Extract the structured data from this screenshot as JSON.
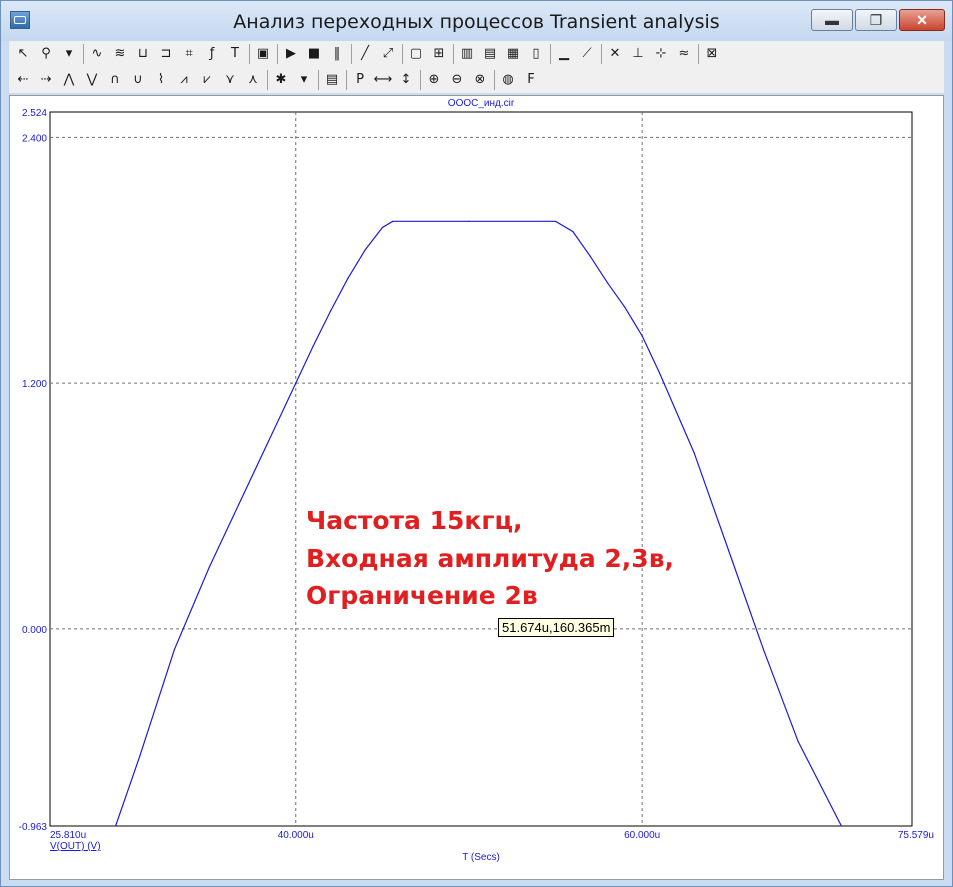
{
  "window": {
    "title": "Анализ переходных процессов Transient analysis"
  },
  "titlebar_buttons": {
    "min": "▬",
    "max": "❐",
    "close": "✕"
  },
  "toolbar1": [
    {
      "name": "select-arrow-icon",
      "glyph": "↖"
    },
    {
      "name": "scale-icon",
      "glyph": "⚲"
    },
    {
      "name": "dropdown-arrow-icon",
      "glyph": "▾"
    },
    {
      "name": "waveform-icon",
      "glyph": "∿"
    },
    {
      "name": "waveform-2-icon",
      "glyph": "≋"
    },
    {
      "name": "waveform-3-icon",
      "glyph": "⊔"
    },
    {
      "name": "waveform-4-icon",
      "glyph": "⊐"
    },
    {
      "name": "data-points-icon",
      "glyph": "⌗"
    },
    {
      "name": "formula-icon",
      "glyph": "ƒ"
    },
    {
      "name": "text-icon",
      "glyph": "T"
    },
    {
      "name": "properties-icon",
      "glyph": "▣"
    },
    {
      "name": "run-icon",
      "glyph": "▶"
    },
    {
      "name": "stop-icon",
      "glyph": "■"
    },
    {
      "name": "pause-icon",
      "glyph": "‖"
    },
    {
      "name": "line-icon",
      "glyph": "╱"
    },
    {
      "name": "line-2-icon",
      "glyph": "⤢"
    },
    {
      "name": "frame-icon",
      "glyph": "▢"
    },
    {
      "name": "grid-icon",
      "glyph": "⊞"
    },
    {
      "name": "grid-v-icon",
      "glyph": "▥"
    },
    {
      "name": "grid-h-icon",
      "glyph": "▤"
    },
    {
      "name": "grid-2-icon",
      "glyph": "▦"
    },
    {
      "name": "grid-3-icon",
      "glyph": "▯"
    },
    {
      "name": "baseline-icon",
      "glyph": "▁"
    },
    {
      "name": "trace-icon",
      "glyph": "⟋"
    },
    {
      "name": "marker-icon",
      "glyph": "✕"
    },
    {
      "name": "marker-2-icon",
      "glyph": "⊥"
    },
    {
      "name": "marker-3-icon",
      "glyph": "⊹"
    },
    {
      "name": "marker-4-icon",
      "glyph": "≈"
    },
    {
      "name": "clear-icon",
      "glyph": "⊠"
    }
  ],
  "toolbar2": [
    {
      "name": "cursor-left-icon",
      "glyph": "⇠"
    },
    {
      "name": "cursor-right-icon",
      "glyph": "⇢"
    },
    {
      "name": "peak-icon",
      "glyph": "⋀"
    },
    {
      "name": "valley-icon",
      "glyph": "⋁"
    },
    {
      "name": "high-icon",
      "glyph": "∩"
    },
    {
      "name": "low-icon",
      "glyph": "∪"
    },
    {
      "name": "inflection-icon",
      "glyph": "⌇"
    },
    {
      "name": "global-high-icon",
      "glyph": "⩘"
    },
    {
      "name": "global-low-icon",
      "glyph": "⩗"
    },
    {
      "name": "top-icon",
      "glyph": "⋎"
    },
    {
      "name": "bottom-icon",
      "glyph": "⋏"
    },
    {
      "name": "tokens-icon",
      "glyph": "✱"
    },
    {
      "name": "dropdown-2-icon",
      "glyph": "▾"
    },
    {
      "name": "table-icon",
      "glyph": "▤"
    },
    {
      "name": "point-tag-icon",
      "glyph": "P"
    },
    {
      "name": "horizontal-tag-icon",
      "glyph": "⟷"
    },
    {
      "name": "vertical-tag-icon",
      "glyph": "↕"
    },
    {
      "name": "zoom-in-icon",
      "glyph": "⊕"
    },
    {
      "name": "zoom-out-icon",
      "glyph": "⊖"
    },
    {
      "name": "zoom-fit-icon",
      "glyph": "⊗"
    },
    {
      "name": "color-icon",
      "glyph": "◍"
    },
    {
      "name": "font-icon",
      "glyph": "F"
    }
  ],
  "colors": {
    "trace": "#1a1adc",
    "axis_text": "#1a1adc",
    "grid": "#707070",
    "annotation": "#e02020"
  },
  "chart_data": {
    "type": "line",
    "title": "OOOC_инд.cir",
    "xlabel": "T (Secs)",
    "ylabel": "",
    "series_label": "V(OUT) (V)",
    "xlim": [
      25.81,
      75.579
    ],
    "ylim": [
      -0.963,
      2.524
    ],
    "x_unit": "u",
    "x_ticks": [
      {
        "v": 25.81,
        "label": "25.810u"
      },
      {
        "v": 40,
        "label": "40.000u"
      },
      {
        "v": 60,
        "label": "60.000u"
      },
      {
        "v": 75.579,
        "label": "75.579u"
      }
    ],
    "y_ticks": [
      {
        "v": 2.524,
        "label": "2.524"
      },
      {
        "v": 2.4,
        "label": "2.400"
      },
      {
        "v": 1.2,
        "label": "1.200"
      },
      {
        "v": 0,
        "label": "0.000"
      },
      {
        "v": -0.963,
        "label": "-0.963"
      }
    ],
    "grid": true,
    "series": [
      {
        "name": "V(OUT) (V)",
        "x": [
          29.6,
          31.0,
          33.0,
          35.0,
          37.0,
          39.0,
          40.0,
          41.0,
          42.0,
          43.0,
          44.0,
          45.0,
          45.6,
          50.0,
          55.0,
          56.0,
          57.0,
          58.0,
          59.0,
          60.0,
          61.0,
          63.0,
          65.0,
          67.0,
          69.0,
          71.5
        ],
        "y": [
          -0.963,
          -0.62,
          -0.1,
          0.3,
          0.66,
          1.02,
          1.2,
          1.38,
          1.55,
          1.71,
          1.85,
          1.96,
          1.99,
          1.99,
          1.99,
          1.94,
          1.82,
          1.69,
          1.57,
          1.43,
          1.25,
          0.86,
          0.38,
          -0.1,
          -0.55,
          -0.963
        ]
      }
    ]
  },
  "annotation": {
    "line1": "Частота 15кгц,",
    "line2": "Входная амплитуда 2,3в,",
    "line3": "Ограничение 2в"
  },
  "tooltip": {
    "text": "51.674u,160.365m"
  }
}
